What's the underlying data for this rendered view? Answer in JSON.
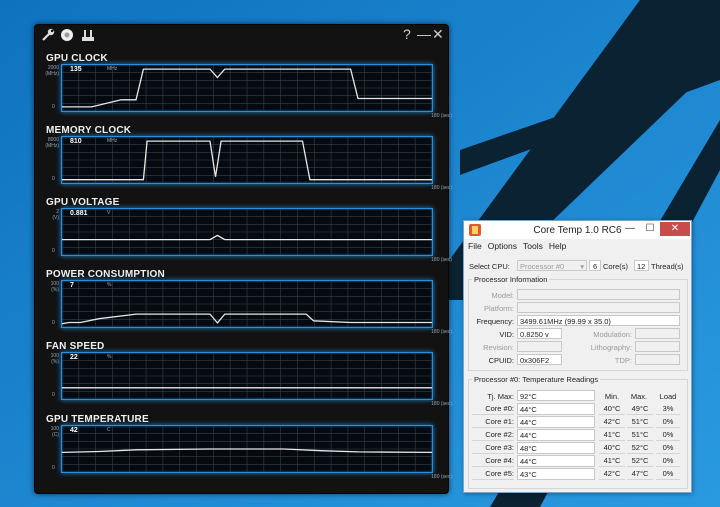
{
  "gpu_monitor": {
    "window_controls": {
      "help": "?",
      "minimize": "—",
      "close": "✕"
    },
    "sections": [
      {
        "title": "GPU CLOCK",
        "y_max": "2000",
        "y_unit": "(MHz)",
        "y_min": "0",
        "value": "135",
        "unit": "MHz",
        "time_label": "180 (sec)"
      },
      {
        "title": "MEMORY CLOCK",
        "y_max": "8000",
        "y_unit": "(MHz)",
        "y_min": "0",
        "value": "810",
        "unit": "MHz",
        "time_label": "180 (sec)"
      },
      {
        "title": "GPU VOLTAGE",
        "y_max": "2",
        "y_unit": "(V)",
        "y_min": "0",
        "value": "0.881",
        "unit": "V",
        "time_label": "180 (sec)"
      },
      {
        "title": "POWER CONSUMPTION",
        "y_max": "100",
        "y_unit": "(%)",
        "y_min": "0",
        "value": "7",
        "unit": "%",
        "time_label": "180 (sec)"
      },
      {
        "title": "FAN SPEED",
        "y_max": "100",
        "y_unit": "(%)",
        "y_min": "0",
        "value": "22",
        "unit": "%",
        "time_label": "180 (sec)"
      },
      {
        "title": "GPU TEMPERATURE",
        "y_max": "100",
        "y_unit": "(C)",
        "y_min": "0",
        "value": "42",
        "unit": "C",
        "time_label": "180 (sec)"
      }
    ],
    "traces": [
      [
        [
          0,
          0.05
        ],
        [
          0.08,
          0.05
        ],
        [
          0.16,
          0.22
        ],
        [
          0.2,
          0.22
        ],
        [
          0.22,
          0.95
        ],
        [
          0.4,
          0.95
        ],
        [
          0.42,
          0.75
        ],
        [
          0.44,
          0.95
        ],
        [
          0.78,
          0.95
        ],
        [
          0.8,
          0.25
        ],
        [
          0.9,
          0.25
        ],
        [
          1,
          0.25
        ]
      ],
      [
        [
          0,
          0.03
        ],
        [
          0.22,
          0.03
        ],
        [
          0.23,
          0.95
        ],
        [
          0.4,
          0.95
        ],
        [
          0.415,
          0.1
        ],
        [
          0.43,
          0.95
        ],
        [
          0.65,
          0.95
        ],
        [
          0.67,
          0.03
        ],
        [
          1,
          0.03
        ]
      ],
      [
        [
          0,
          0.32
        ],
        [
          0.4,
          0.32
        ],
        [
          0.42,
          0.42
        ],
        [
          0.44,
          0.32
        ],
        [
          1,
          0.32
        ]
      ],
      [
        [
          0,
          0.03
        ],
        [
          0.02,
          0.06
        ],
        [
          0.05,
          0.06
        ],
        [
          0.1,
          0.15
        ],
        [
          0.2,
          0.26
        ],
        [
          0.4,
          0.26
        ],
        [
          0.42,
          0.05
        ],
        [
          0.44,
          0.26
        ],
        [
          0.66,
          0.26
        ],
        [
          0.68,
          0.1
        ],
        [
          0.78,
          0.06
        ],
        [
          1,
          0.06
        ]
      ],
      [
        [
          0,
          0.22
        ],
        [
          1,
          0.22
        ]
      ],
      [
        [
          0,
          0.42
        ],
        [
          0.1,
          0.44
        ],
        [
          0.2,
          0.48
        ],
        [
          0.4,
          0.5
        ],
        [
          0.6,
          0.5
        ],
        [
          0.7,
          0.46
        ],
        [
          0.8,
          0.43
        ],
        [
          1,
          0.42
        ]
      ]
    ],
    "colors": {
      "line": "#e8e8e8",
      "grid": "#3a3f45",
      "frame": "#2f8fd6"
    }
  },
  "core_temp": {
    "title": "Core Temp 1.0 RC6",
    "window_controls": {
      "minimize": "—",
      "maximize": "☐",
      "close": "✕"
    },
    "menu": [
      "File",
      "Options",
      "Tools",
      "Help"
    ],
    "select_cpu": {
      "label": "Select CPU:",
      "value": "Processor #0",
      "cores_value": "6",
      "cores_label": "Core(s)",
      "threads_value": "12",
      "threads_label": "Thread(s)"
    },
    "processor_info": {
      "title": "Processor Information",
      "model_label": "Model:",
      "model_value": "",
      "platform_label": "Platform:",
      "platform_value": "",
      "frequency_label": "Frequency:",
      "frequency_value": "3499.61MHz (99.99 x 35.0)",
      "vid_label": "VID:",
      "vid_value": "0.8250 v",
      "modulation_label": "Modulation:",
      "modulation_value": "",
      "revision_label": "Revision:",
      "revision_value": "",
      "lithography_label": "Lithography:",
      "lithography_value": "",
      "cpuid_label": "CPUID:",
      "cpuid_value": "0x306F2",
      "tdp_label": "TDP:",
      "tdp_value": ""
    },
    "temperature": {
      "title": "Processor #0: Temperature Readings",
      "tj_max_label": "Tj. Max:",
      "tj_max_value": "92°C",
      "headers": {
        "min": "Min.",
        "max": "Max.",
        "load": "Load"
      },
      "cores": [
        {
          "name": "Core #0:",
          "temp": "44°C",
          "min": "40°C",
          "max": "49°C",
          "load": "3%"
        },
        {
          "name": "Core #1:",
          "temp": "44°C",
          "min": "42°C",
          "max": "51°C",
          "load": "0%"
        },
        {
          "name": "Core #2:",
          "temp": "44°C",
          "min": "41°C",
          "max": "51°C",
          "load": "0%"
        },
        {
          "name": "Core #3:",
          "temp": "48°C",
          "min": "40°C",
          "max": "52°C",
          "load": "0%"
        },
        {
          "name": "Core #4:",
          "temp": "44°C",
          "min": "41°C",
          "max": "52°C",
          "load": "0%"
        },
        {
          "name": "Core #5:",
          "temp": "43°C",
          "min": "42°C",
          "max": "47°C",
          "load": "0%"
        }
      ]
    }
  }
}
